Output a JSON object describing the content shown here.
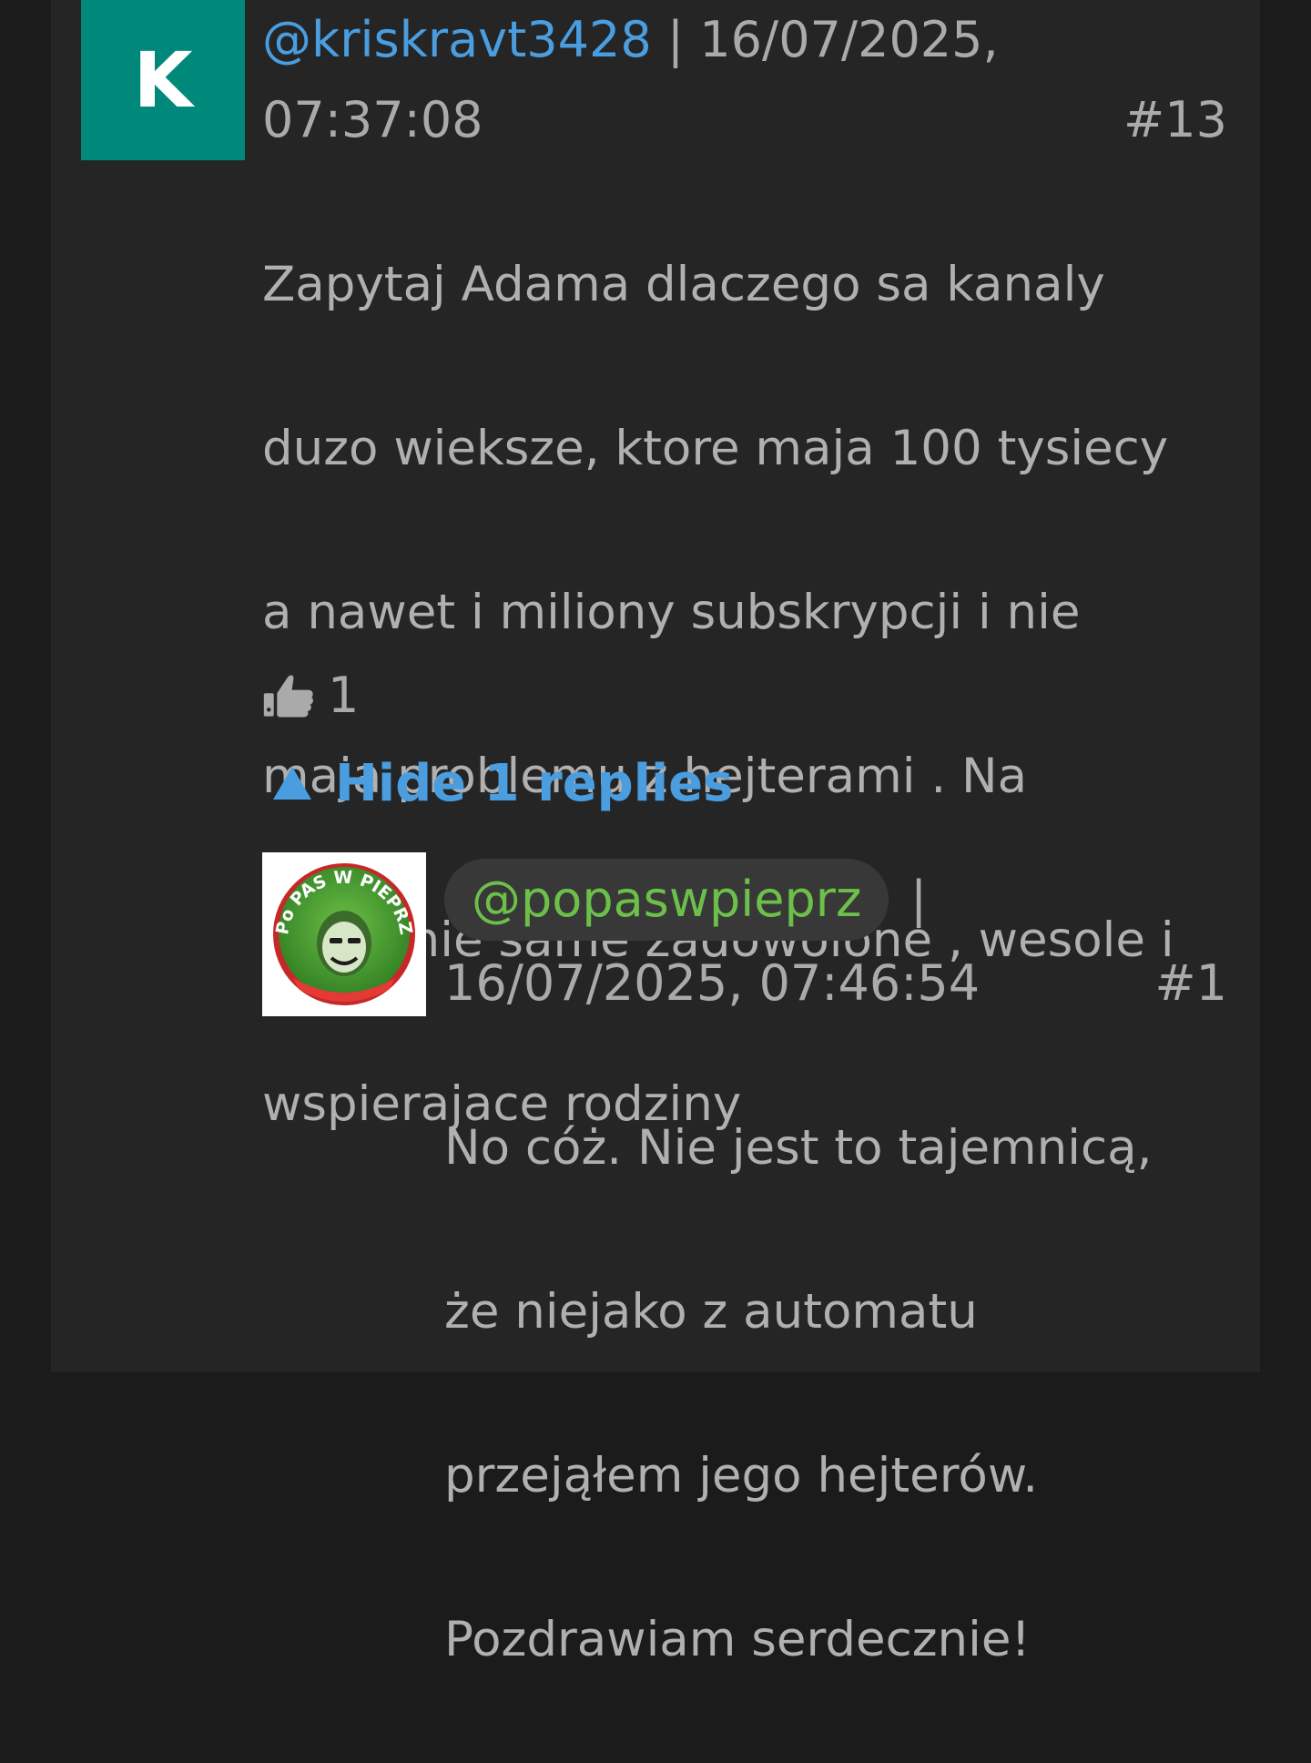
{
  "comment": {
    "avatar_letter": "K",
    "username": "@kriskravt3428",
    "separator": "|",
    "date": "16/07/2025,",
    "time": "07:37:08",
    "number": "#13",
    "text_lines": [
      "Zapytaj Adama dlaczego sa kanaly",
      "duzo wieksze, ktore maja 100 tysiecy",
      "a nawet i miliony subskrypcji i nie",
      "maja problemu z hejterami . Na",
      "stadionie same zadowolone , wesole i",
      "wspierajace rodziny"
    ],
    "likes_icon": "thumbs-up-icon",
    "likes_count": "1",
    "toggle_label": "Hide 1 replies"
  },
  "reply": {
    "avatar_icon": "channel-logo-avatar",
    "avatar_logo_text": "Po PAS W PIEPRZ",
    "username": "@popaswpieprz",
    "separator": "|",
    "datetime": "16/07/2025, 07:46:54",
    "number": "#1",
    "text_lines": [
      "No cóż. Nie jest to tajemnicą,",
      "że niejako z automatu",
      "przejąłem jego hejterów.",
      "Pozdrawiam serdecznie!"
    ]
  },
  "colors": {
    "background": "#1b1b1b",
    "panel": "#252525",
    "avatar_teal": "#00897b",
    "link_blue": "#4a9ee0",
    "owner_green": "#6cc04a",
    "text_gray": "#b0b0b0"
  }
}
